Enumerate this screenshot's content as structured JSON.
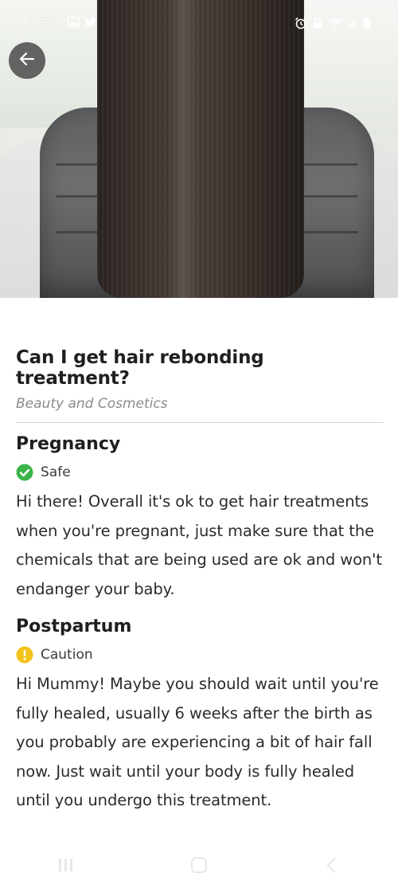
{
  "status_bar": {
    "time": "7:53",
    "left_icons": [
      "gallery-icon",
      "twitter-icon"
    ],
    "right_icons": [
      "alarm-icon",
      "lock-icon",
      "wifi-icon",
      "signal-icon",
      "battery-icon"
    ]
  },
  "header": {
    "back_icon": "arrow-left-icon",
    "hero_image": "long straight dark hair over salon cape"
  },
  "question": {
    "title": "Can I get hair rebonding treatment?",
    "category": "Beauty and Cosmetics"
  },
  "sections": [
    {
      "title": "Pregnancy",
      "status": "Safe",
      "status_icon": "check-circle-icon",
      "status_color": "#3bb54a",
      "answer": "Hi there! Overall it's ok to get hair treatments when you're pregnant, just make sure that the chemicals that are being used are ok and won't endanger your baby."
    },
    {
      "title": "Postpartum",
      "status": "Caution",
      "status_icon": "exclamation-circle-icon",
      "status_color": "#f2c31b",
      "answer": "Hi Mummy! Maybe you should wait until you're fully healed, usually 6 weeks after the birth as you probably are experiencing a bit of hair fall now. Just wait until your body is fully healed until you undergo this treatment."
    }
  ],
  "nav_bar": {
    "items": [
      "recents-icon",
      "home-icon",
      "back-icon"
    ]
  }
}
